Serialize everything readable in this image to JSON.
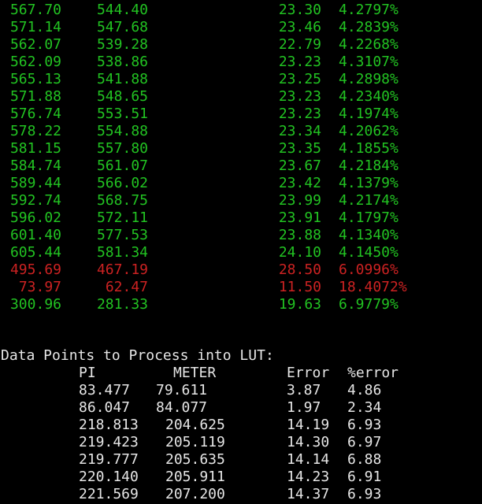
{
  "colors": {
    "background": "#000000",
    "normal_row": "#22c322",
    "error_row": "#cc2222",
    "plain_text": "#e6e6e6"
  },
  "top_rows": [
    {
      "pi": "567.70",
      "meter": "544.40",
      "error": "23.30",
      "pct": "4.2797%",
      "status": "green"
    },
    {
      "pi": "571.14",
      "meter": "547.68",
      "error": "23.46",
      "pct": "4.2839%",
      "status": "green"
    },
    {
      "pi": "562.07",
      "meter": "539.28",
      "error": "22.79",
      "pct": "4.2268%",
      "status": "green"
    },
    {
      "pi": "562.09",
      "meter": "538.86",
      "error": "23.23",
      "pct": "4.3107%",
      "status": "green"
    },
    {
      "pi": "565.13",
      "meter": "541.88",
      "error": "23.25",
      "pct": "4.2898%",
      "status": "green"
    },
    {
      "pi": "571.88",
      "meter": "548.65",
      "error": "23.23",
      "pct": "4.2340%",
      "status": "green"
    },
    {
      "pi": "576.74",
      "meter": "553.51",
      "error": "23.23",
      "pct": "4.1974%",
      "status": "green"
    },
    {
      "pi": "578.22",
      "meter": "554.88",
      "error": "23.34",
      "pct": "4.2062%",
      "status": "green"
    },
    {
      "pi": "581.15",
      "meter": "557.80",
      "error": "23.35",
      "pct": "4.1855%",
      "status": "green"
    },
    {
      "pi": "584.74",
      "meter": "561.07",
      "error": "23.67",
      "pct": "4.2184%",
      "status": "green"
    },
    {
      "pi": "589.44",
      "meter": "566.02",
      "error": "23.42",
      "pct": "4.1379%",
      "status": "green"
    },
    {
      "pi": "592.74",
      "meter": "568.75",
      "error": "23.99",
      "pct": "4.2174%",
      "status": "green"
    },
    {
      "pi": "596.02",
      "meter": "572.11",
      "error": "23.91",
      "pct": "4.1797%",
      "status": "green"
    },
    {
      "pi": "601.40",
      "meter": "577.53",
      "error": "23.88",
      "pct": "4.1340%",
      "status": "green"
    },
    {
      "pi": "605.44",
      "meter": "581.34",
      "error": "24.10",
      "pct": "4.1450%",
      "status": "green"
    },
    {
      "pi": "495.69",
      "meter": "467.19",
      "error": "28.50",
      "pct": "6.0996%",
      "status": "red"
    },
    {
      "pi": "73.97",
      "meter": "62.47",
      "error": "11.50",
      "pct": "18.4072%",
      "status": "red"
    },
    {
      "pi": "300.96",
      "meter": "281.33",
      "error": "19.63",
      "pct": "6.9779%",
      "status": "green"
    }
  ],
  "lut": {
    "heading": "Data Points to Process into LUT:",
    "columns": {
      "pi": "PI",
      "meter": "METER",
      "error": "Error",
      "pct": "%error"
    },
    "rows": [
      {
        "pi": "83.477",
        "meter": "79.611",
        "error": "3.87",
        "pct": "4.86"
      },
      {
        "pi": "86.047",
        "meter": "84.077",
        "error": "1.97",
        "pct": "2.34"
      },
      {
        "pi": "218.813",
        "meter": "204.625",
        "error": "14.19",
        "pct": "6.93"
      },
      {
        "pi": "219.423",
        "meter": "205.119",
        "error": "14.30",
        "pct": "6.97"
      },
      {
        "pi": "219.777",
        "meter": "205.635",
        "error": "14.14",
        "pct": "6.88"
      },
      {
        "pi": "220.140",
        "meter": "205.911",
        "error": "14.23",
        "pct": "6.91"
      },
      {
        "pi": "221.569",
        "meter": "207.200",
        "error": "14.37",
        "pct": "6.93"
      }
    ]
  }
}
